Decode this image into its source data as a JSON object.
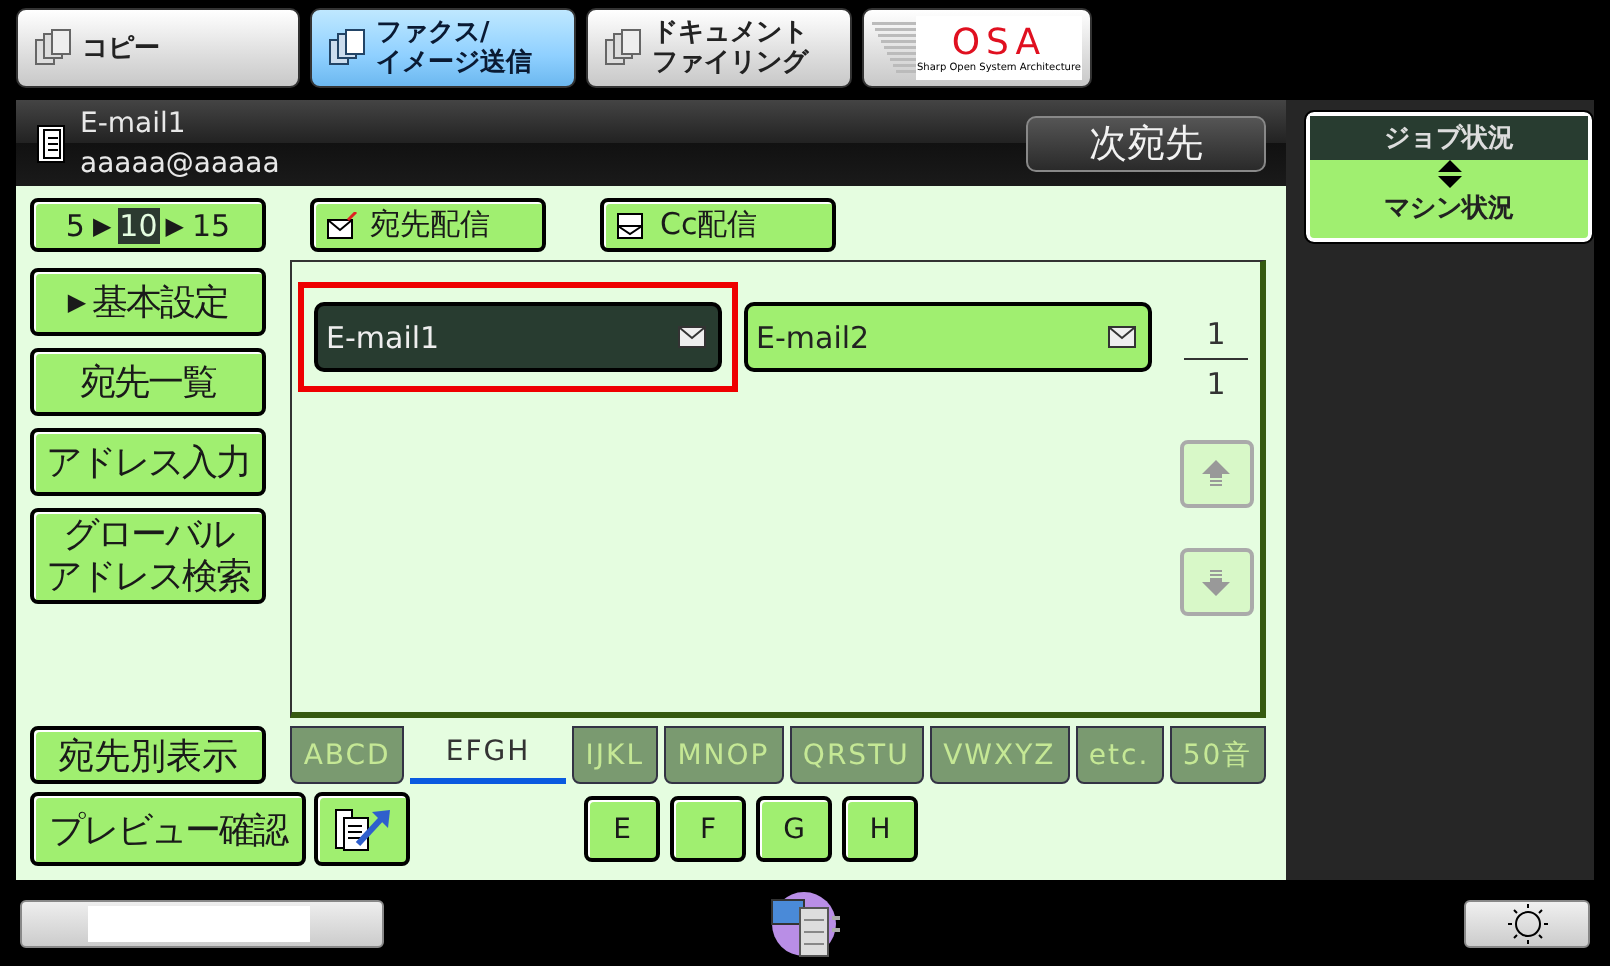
{
  "mode_tabs": [
    {
      "lines": [
        "コピー"
      ],
      "selected": false
    },
    {
      "lines": [
        "ファクス/",
        "イメージ送信"
      ],
      "selected": true
    },
    {
      "lines": [
        "ドキュメント",
        "ファイリング"
      ],
      "selected": false
    },
    {
      "kind": "logo",
      "label": "OSA",
      "caption": "Sharp Open System Architecture",
      "selected": false
    }
  ],
  "header": {
    "name": "E-mail1",
    "address": "aaaaa@aaaaa",
    "next_button": "次宛先"
  },
  "range_selector": [
    {
      "kind": "option",
      "label": "5",
      "selected": false
    },
    {
      "kind": "separator",
      "label": "▶"
    },
    {
      "kind": "option",
      "label": "10",
      "selected": true
    },
    {
      "kind": "separator",
      "label": "▶"
    },
    {
      "kind": "option",
      "label": "15",
      "selected": false
    }
  ],
  "delivery_buttons": [
    {
      "label": "宛先配信"
    },
    {
      "label": "Cc配信"
    }
  ],
  "nav_buttons": [
    {
      "label": "基本設定",
      "marker": "▶"
    },
    {
      "label": "宛先一覧"
    },
    {
      "label": "アドレス入力"
    },
    {
      "lines": [
        "グローバル",
        "アドレス検索"
      ]
    }
  ],
  "entries": [
    {
      "label": "E-mail1",
      "selected": true
    },
    {
      "label": "E-mail2",
      "selected": false
    }
  ],
  "page": {
    "current": "1",
    "total": "1"
  },
  "scroll": {
    "up_disabled": true,
    "down_disabled": true
  },
  "view_button": "宛先別表示",
  "index_tabs": [
    {
      "label": "ABCD",
      "selected": false
    },
    {
      "label": "EFGH",
      "selected": true
    },
    {
      "label": "IJKL",
      "selected": false
    },
    {
      "label": "MNOP",
      "selected": false
    },
    {
      "label": "QRSTU",
      "selected": false
    },
    {
      "label": "VWXYZ",
      "selected": false
    },
    {
      "label": "etc.",
      "selected": false
    },
    {
      "label": "50音",
      "selected": false
    }
  ],
  "preview_button": "プレビュー確認",
  "letter_buttons": [
    "E",
    "F",
    "G",
    "H"
  ],
  "status_button": {
    "top": "ジョブ状況",
    "bottom": "マシン状況"
  }
}
